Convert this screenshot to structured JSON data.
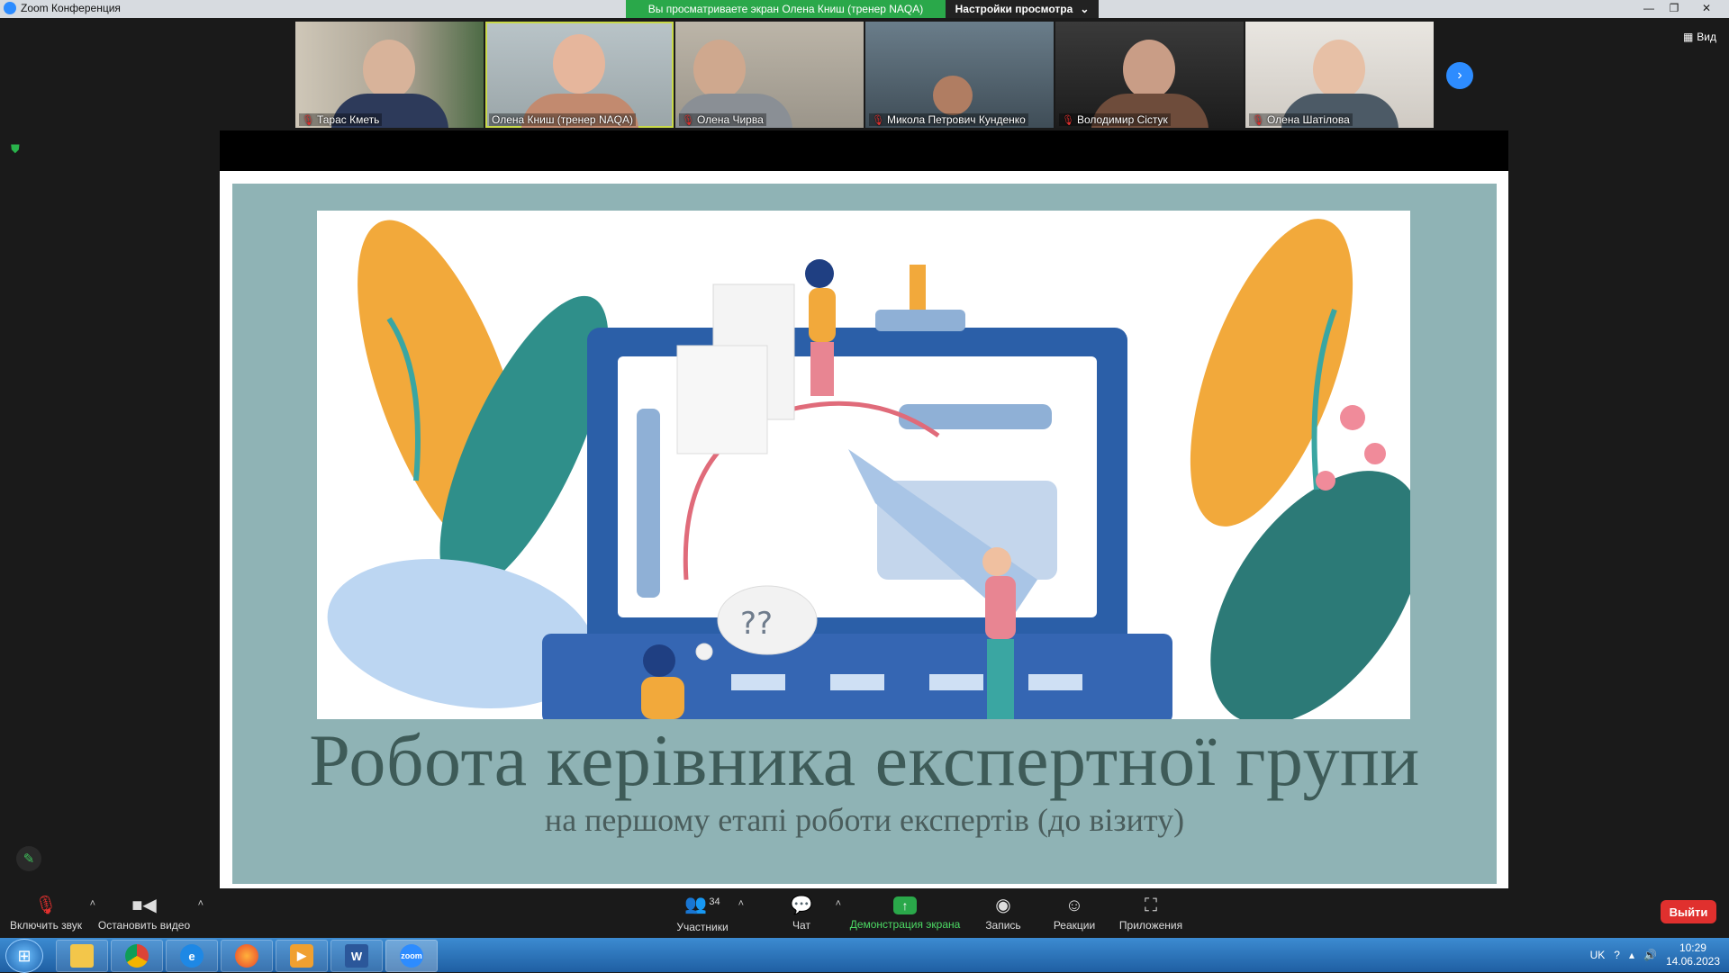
{
  "window": {
    "title": "Zoom Конференция",
    "share_banner": "Вы просматриваете экран Олена Книш (тренер NAQA)",
    "view_settings": "Настройки просмотра",
    "view_button": "Вид"
  },
  "participants": [
    {
      "name": "Тарас Кметь",
      "muted": true
    },
    {
      "name": "Олена Книш (тренер NAQA)",
      "muted": false
    },
    {
      "name": "Олена Чирва",
      "muted": true
    },
    {
      "name": "Микола  Петрович Кунденко",
      "muted": true
    },
    {
      "name": "Володимир  Сістук",
      "muted": true
    },
    {
      "name": "Олена Шатілова",
      "muted": true
    }
  ],
  "slide": {
    "title": "Робота керівника експертної групи",
    "subtitle": "на першому етапі роботи експертів (до візиту)",
    "bubble_text": "??"
  },
  "controls": {
    "audio": "Включить звук",
    "video": "Остановить видео",
    "participants": "Участники",
    "participants_count": "34",
    "chat": "Чат",
    "share": "Демонстрация экрана",
    "record": "Запись",
    "reactions": "Реакции",
    "apps": "Приложения",
    "leave": "Выйти"
  },
  "taskbar": {
    "lang": "UK",
    "time": "10:29",
    "date": "14.06.2023",
    "zoom_label": "zoom",
    "word_label": "W"
  },
  "colors": {
    "zoom_blue": "#2d8cff",
    "share_green": "#2aa84a",
    "leave_red": "#e0302e",
    "slide_bg": "#8fb3b5",
    "slide_title": "#3e5b58"
  }
}
